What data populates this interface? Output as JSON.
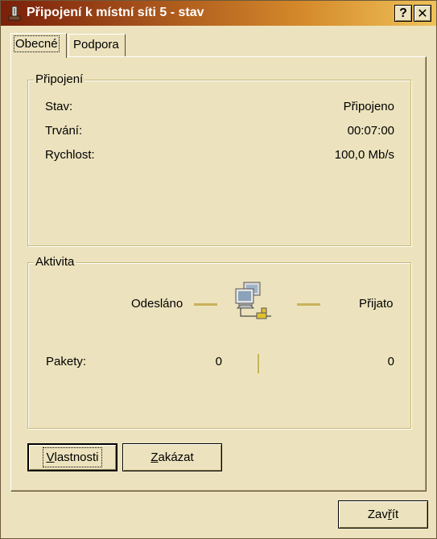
{
  "window": {
    "title": "Připojení k místní síti 5 - stav"
  },
  "titlebar_buttons": {
    "help": "?",
    "close": "✕"
  },
  "tabs": [
    {
      "label": "Obecné",
      "active": true
    },
    {
      "label": "Podpora",
      "active": false
    }
  ],
  "connection": {
    "legend": "Připojení",
    "rows": [
      {
        "label": "Stav:",
        "value": "Připojeno"
      },
      {
        "label": "Trvání:",
        "value": "00:07:00"
      },
      {
        "label": "Rychlost:",
        "value": "100,0 Mb/s"
      }
    ]
  },
  "activity": {
    "legend": "Aktivita",
    "sent_label": "Odesláno",
    "received_label": "Přijato",
    "packets_label": "Pakety:",
    "packets_sent": "0",
    "packets_received": "0",
    "icon": "network-computers-icon"
  },
  "buttons": {
    "properties": {
      "first": "V",
      "rest": "lastnosti"
    },
    "disable": {
      "first": "Z",
      "rest": "akázat"
    },
    "close": {
      "pre": "Zav",
      "u": "ř",
      "post": "ít"
    }
  },
  "colors": {
    "face": "#ECE3BE",
    "titlebar_start": "#7a1f0a",
    "titlebar_end": "#efc25a",
    "activity_line": "#c9b25a"
  }
}
